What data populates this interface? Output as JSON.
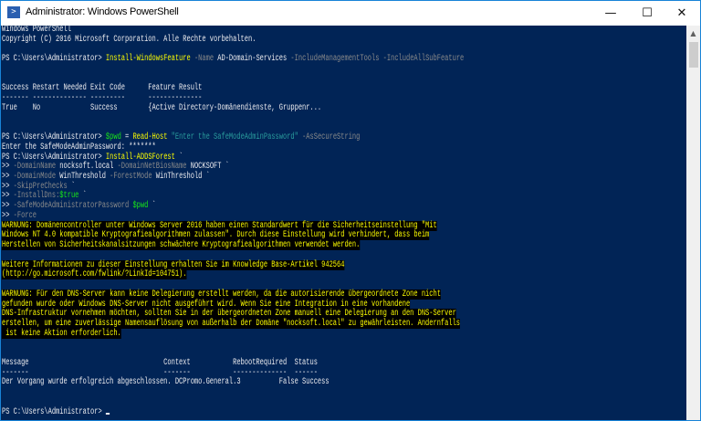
{
  "window": {
    "title": "Administrator: Windows PowerShell",
    "icon": "powershell-icon",
    "controls": {
      "minimize": "—",
      "maximize": "☐",
      "close": "✕"
    }
  },
  "colors": {
    "background": "#012456",
    "command": "#ffff00",
    "parameter": "#8a8a8a",
    "string": "#2a9d9d",
    "variable": "#19e619",
    "warning_fg": "#ffff00",
    "warning_bg": "#000000"
  },
  "console": {
    "lines": [
      [
        {
          "t": "Windows PowerShell",
          "c": ""
        }
      ],
      [
        {
          "t": "Copyright (C) 2016 Microsoft Corporation. Alle Rechte vorbehalten.",
          "c": ""
        }
      ],
      [],
      [
        {
          "t": "PS C:\\Users\\Administrator> ",
          "c": ""
        },
        {
          "t": "Install-WindowsFeature",
          "c": "cmd"
        },
        {
          "t": " -Name",
          "c": "par"
        },
        {
          "t": " AD-Domain-Services",
          "c": ""
        },
        {
          "t": " -IncludeManagementTools -IncludeAllSubFeature",
          "c": "par"
        }
      ],
      [],
      [],
      [
        {
          "t": "Success Restart Needed Exit Code      Feature Result",
          "c": ""
        }
      ],
      [
        {
          "t": "------- -------------- ---------      --------------",
          "c": ""
        }
      ],
      [
        {
          "t": "True    No             Success        {Active Directory-Domänendienste, Gruppenr...",
          "c": ""
        }
      ],
      [],
      [],
      [
        {
          "t": "PS C:\\Users\\Administrator> ",
          "c": ""
        },
        {
          "t": "$pwd",
          "c": "var"
        },
        {
          "t": " = ",
          "c": ""
        },
        {
          "t": "Read-Host",
          "c": "cmd"
        },
        {
          "t": " \"Enter the SafeModeAdminPassword\"",
          "c": "str"
        },
        {
          "t": " -AsSecureString",
          "c": "par"
        }
      ],
      [
        {
          "t": "Enter the SafeModeAdminPassword: *******",
          "c": ""
        }
      ],
      [
        {
          "t": "PS C:\\Users\\Administrator> ",
          "c": ""
        },
        {
          "t": "Install-ADDSForest",
          "c": "cmd"
        },
        {
          "t": " `",
          "c": ""
        }
      ],
      [
        {
          "t": ">> ",
          "c": ""
        },
        {
          "t": "-DomainName",
          "c": "par"
        },
        {
          "t": " nocksoft.local ",
          "c": ""
        },
        {
          "t": "-DomainNetBiosName",
          "c": "par"
        },
        {
          "t": " NOCKSOFT `",
          "c": ""
        }
      ],
      [
        {
          "t": ">> ",
          "c": ""
        },
        {
          "t": "-DomainMode",
          "c": "par"
        },
        {
          "t": " WinThreshold ",
          "c": ""
        },
        {
          "t": "-ForestMode",
          "c": "par"
        },
        {
          "t": " WinThreshold `",
          "c": ""
        }
      ],
      [
        {
          "t": ">> ",
          "c": ""
        },
        {
          "t": "-SkipPreChecks",
          "c": "par"
        },
        {
          "t": " `",
          "c": ""
        }
      ],
      [
        {
          "t": ">> ",
          "c": ""
        },
        {
          "t": "-InstallDns:",
          "c": "par"
        },
        {
          "t": "$true",
          "c": "var"
        },
        {
          "t": " `",
          "c": ""
        }
      ],
      [
        {
          "t": ">> ",
          "c": ""
        },
        {
          "t": "-SafeModeAdministratorPassword",
          "c": "par"
        },
        {
          "t": " ",
          "c": ""
        },
        {
          "t": "$pwd",
          "c": "var"
        },
        {
          "t": " `",
          "c": ""
        }
      ],
      [
        {
          "t": ">> ",
          "c": ""
        },
        {
          "t": "-Force",
          "c": "par"
        }
      ],
      [
        {
          "t": "WARNUNG: Domänencontroller unter Windows Server 2016 haben einen Standardwert für die Sicherheitseinstellung \"Mit",
          "c": "warn"
        }
      ],
      [
        {
          "t": "Windows NT 4.0 kompatible Kryptografiealgorithmen zulassen\". Durch diese Einstellung wird verhindert, dass beim",
          "c": "warn"
        }
      ],
      [
        {
          "t": "Herstellen von Sicherheitskanalsitzungen schwächere Kryptografiealgorithmen verwendet werden.",
          "c": "warn"
        }
      ],
      [],
      [
        {
          "t": "Weitere Informationen zu dieser Einstellung erhalten Sie im Knowledge Base-Artikel 942564",
          "c": "warn"
        }
      ],
      [
        {
          "t": "(http://go.microsoft.com/fwlink/?LinkId=104751).",
          "c": "warn"
        }
      ],
      [],
      [
        {
          "t": "WARNUNG: Für den DNS-Server kann keine Delegierung erstellt werden, da die autorisierende übergeordnete Zone nicht",
          "c": "warn"
        }
      ],
      [
        {
          "t": "gefunden wurde oder Windows DNS-Server nicht ausgeführt wird. Wenn Sie eine Integration in eine vorhandene",
          "c": "warn"
        }
      ],
      [
        {
          "t": "DNS-Infrastruktur vornehmen möchten, sollten Sie in der übergeordneten Zone manuell eine Delegierung an den DNS-Server",
          "c": "warn"
        }
      ],
      [
        {
          "t": "erstellen, um eine zuverlässige Namensauflösung von außerhalb der Domäne \"nocksoft.local\" zu gewährleisten. Andernfalls",
          "c": "warn"
        }
      ],
      [
        {
          "t": " ist keine Aktion erforderlich.",
          "c": "warn"
        }
      ],
      [],
      [],
      [
        {
          "t": "Message                                   Context           RebootRequired  Status",
          "c": ""
        }
      ],
      [
        {
          "t": "-------                                   -------           --------------  ------",
          "c": ""
        }
      ],
      [
        {
          "t": "Der Vorgang wurde erfolgreich abgeschlossen. DCPromo.General.3          False Success",
          "c": ""
        }
      ],
      [],
      [],
      [
        {
          "t": "PS C:\\Users\\Administrator> ",
          "c": ""
        }
      ]
    ]
  }
}
